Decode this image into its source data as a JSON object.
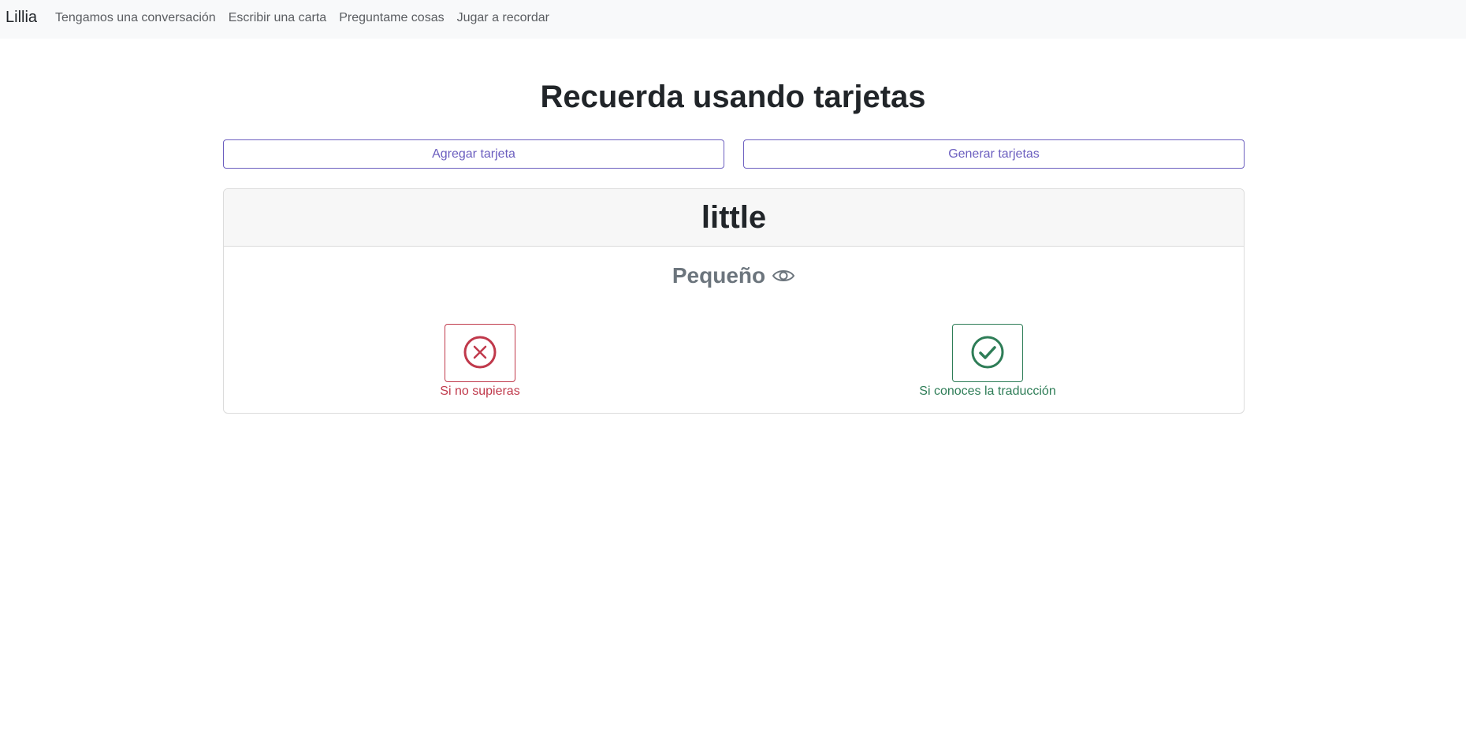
{
  "navbar": {
    "brand": "Lillia",
    "links": [
      {
        "label": "Tengamos una conversación"
      },
      {
        "label": "Escribir una carta"
      },
      {
        "label": "Preguntame cosas"
      },
      {
        "label": "Jugar a recordar"
      }
    ]
  },
  "main": {
    "title": "Recuerda usando tarjetas",
    "add_card_label": "Agregar tarjeta",
    "generate_cards_label": "Generar tarjetas"
  },
  "card": {
    "word": "little",
    "translation": "Pequeño",
    "reveal_icon": "eye-icon",
    "unknown_label": "Si no supieras",
    "unknown_icon": "x-circle-icon",
    "known_label": "Si conoces la traducción",
    "known_icon": "check-circle-icon"
  },
  "colors": {
    "accent": "#6b5ebf",
    "danger": "#c0394b",
    "success": "#2e7d57",
    "muted": "#6c757d",
    "navbar_bg": "#f8f9fa"
  }
}
